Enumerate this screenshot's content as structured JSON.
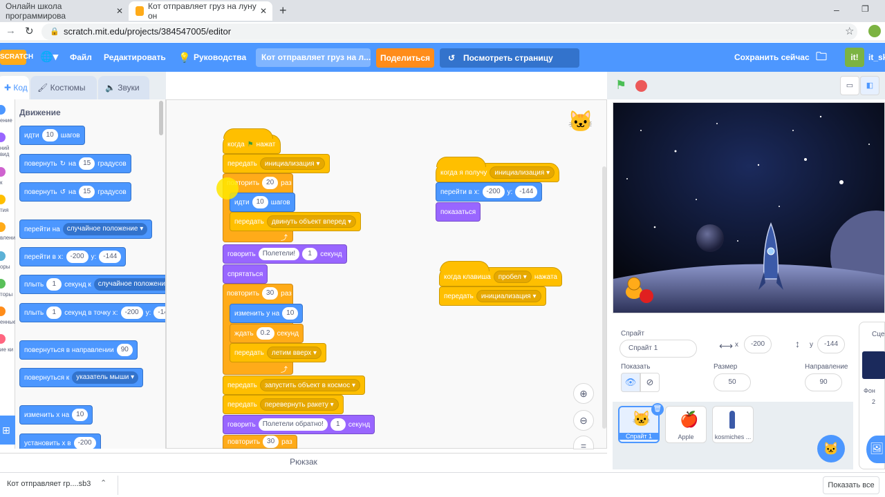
{
  "browser": {
    "tabs": [
      {
        "title": "Онлайн школа программирова"
      },
      {
        "title": "Кот отправляет груз на луну он"
      }
    ],
    "url": "scratch.mit.edu/projects/384547005/editor"
  },
  "menu": {
    "logo": "SCRATCH",
    "file": "Файл",
    "edit": "Редактировать",
    "tutorials": "Руководства",
    "project_title": "Кот отправляет груз на л...",
    "share": "Поделиться",
    "see_project": "Посмотреть страницу проекта",
    "save_now": "Сохранить сейчас",
    "user": "it_sk"
  },
  "editor_tabs": {
    "code": "Код",
    "costumes": "Костюмы",
    "sounds": "Звуки"
  },
  "categories": [
    {
      "label": "ение",
      "color": "#4c97ff"
    },
    {
      "label": "ний вид",
      "color": "#9966ff"
    },
    {
      "label": "к",
      "color": "#cf63cf"
    },
    {
      "label": "тия",
      "color": "#ffbf00"
    },
    {
      "label": "вление",
      "color": "#ffab19"
    },
    {
      "label": "оры",
      "color": "#5cb1d6"
    },
    {
      "label": "торы",
      "color": "#59c059"
    },
    {
      "label": "енные",
      "color": "#ff8c1a"
    },
    {
      "label": "ие ки",
      "color": "#ff6680"
    }
  ],
  "palette": {
    "heading": "Движение",
    "blocks": {
      "move": {
        "a": "идти",
        "v": "10",
        "b": "шагов"
      },
      "turn_cw": {
        "a": "повернуть",
        "b": "на",
        "v": "15",
        "c": "градусов"
      },
      "turn_ccw": {
        "a": "повернуть",
        "b": "на",
        "v": "15",
        "c": "градусов"
      },
      "goto": {
        "a": "перейти на",
        "d": "случайное положение"
      },
      "gotoxy": {
        "a": "перейти в x:",
        "x": "-200",
        "b": "y:",
        "y": "-144"
      },
      "glide": {
        "a": "плыть",
        "v": "1",
        "b": "секунд к",
        "d": "случайное положение"
      },
      "glidexy": {
        "a": "плыть",
        "v": "1",
        "b": "секунд в точку x:",
        "x": "-200",
        "c": "y:",
        "y": "-14"
      },
      "point": {
        "a": "повернуться в направлении",
        "v": "90"
      },
      "pointto": {
        "a": "повернуться к",
        "d": "указатель мыши"
      },
      "changex": {
        "a": "изменить х на",
        "v": "10"
      },
      "setx": {
        "a": "установить х в",
        "v": "-200"
      }
    }
  },
  "script1": {
    "when": "когда",
    "clicked": "нажат",
    "broadcast1": {
      "a": "передать",
      "d": "инициализация"
    },
    "repeat1": {
      "a": "повторить",
      "v": "20",
      "b": "раз"
    },
    "move": {
      "a": "идти",
      "v": "10",
      "b": "шагов"
    },
    "broadcast2": {
      "a": "передать",
      "d": "двинуть объект вперед"
    },
    "say1": {
      "a": "говорить",
      "t": "Полетели!",
      "v": "1",
      "b": "секунд"
    },
    "hide": "спрятаться",
    "repeat2": {
      "a": "повторить",
      "v": "30",
      "b": "раз"
    },
    "changey": {
      "a": "изменить у на",
      "v": "10"
    },
    "wait": {
      "a": "ждать",
      "v": "0.2",
      "b": "секунд"
    },
    "broadcast3": {
      "a": "передать",
      "d": "летим вверх"
    },
    "broadcast4": {
      "a": "передать",
      "d": "запустить объект в космос"
    },
    "broadcast5": {
      "a": "передать",
      "d": "перевернуть ракету"
    },
    "say2": {
      "a": "говорить",
      "t": "Полетели обратно!",
      "v": "1",
      "b": "секунд"
    },
    "repeat3": {
      "a": "повторить",
      "v": "30",
      "b": "раз"
    }
  },
  "script2": {
    "when": "когда я получу",
    "d": "инициализация",
    "gotoxy": {
      "a": "перейти в х:",
      "x": "-200",
      "b": "у:",
      "y": "-144"
    },
    "show": "показаться"
  },
  "script3": {
    "when": "когда клавиша",
    "key": "пробел",
    "pressed": "нажата",
    "broadcast": {
      "a": "передать",
      "d": "инициализация"
    }
  },
  "backpack": "Рюкзак",
  "sprite_info": {
    "sprite_label": "Спрайт",
    "sprite_name": "Спрайт 1",
    "x_label": "x",
    "x": "-200",
    "y_label": "y",
    "y": "-144",
    "show_label": "Показать",
    "size_label": "Размер",
    "size": "50",
    "direction_label": "Направление",
    "direction": "90"
  },
  "sprites": [
    {
      "name": "Спрайт 1",
      "selected": true
    },
    {
      "name": "Apple",
      "selected": false
    },
    {
      "name": "kosmiches ...",
      "selected": false
    }
  ],
  "stage_pane": {
    "scene": "Сцен",
    "backdrops": "Фон",
    "count": "2"
  },
  "download": {
    "file": "Кот отправляет гр....sb3",
    "show_all": "Показать все"
  }
}
